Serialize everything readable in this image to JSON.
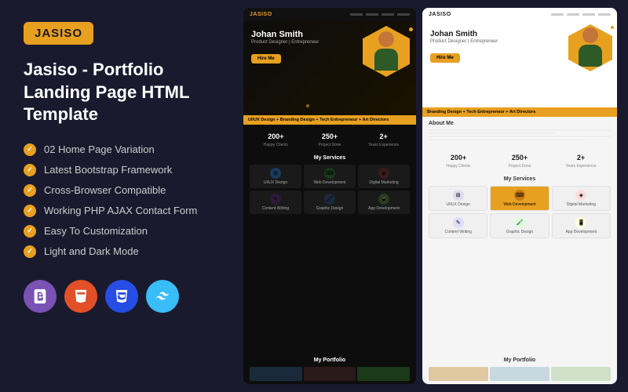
{
  "brand": {
    "name": "JASISO"
  },
  "leftPanel": {
    "title": "Jasiso - Portfolio Landing Page HTML Template",
    "features": [
      {
        "id": "feat1",
        "text": "02 Home Page Variation"
      },
      {
        "id": "feat2",
        "text": "Latest Bootstrap Framework"
      },
      {
        "id": "feat3",
        "text": "Cross-Browser Compatible"
      },
      {
        "id": "feat4",
        "text": "Working PHP AJAX Contact Form"
      },
      {
        "id": "feat5",
        "text": "Easy To Customization"
      },
      {
        "id": "feat6",
        "text": "Light and Dark Mode"
      }
    ],
    "techIcons": [
      {
        "id": "bootstrap",
        "label": "B",
        "title": "Bootstrap"
      },
      {
        "id": "html5",
        "label": "5",
        "title": "HTML5"
      },
      {
        "id": "css3",
        "label": "3",
        "title": "CSS3"
      },
      {
        "id": "tailwind",
        "label": "~",
        "title": "Tailwind"
      }
    ]
  },
  "darkPreview": {
    "navBrand": "JASISO",
    "heroName": "Johan Smith",
    "heroSub": "Product Designer | Entrepreneur",
    "heroBtnLabel": "Hire Me",
    "ticker": "UI/UX Design  +  Branding Design  +  Tech Entrepreneur  +  Art Directors",
    "stats": [
      {
        "num": "200+",
        "label": "Happy Clients"
      },
      {
        "num": "250+",
        "label": "Project Done"
      },
      {
        "num": "2+",
        "label": "Years Experience"
      }
    ],
    "servicesTitle": "My Services",
    "services": [
      {
        "name": "UI/UX Design",
        "icon": "⊞"
      },
      {
        "name": "Web Development",
        "icon": "⌨"
      },
      {
        "name": "Digital Marketing",
        "icon": "◈"
      },
      {
        "name": "Content Writing",
        "icon": "✎"
      },
      {
        "name": "Graphic Design",
        "icon": "🖌"
      },
      {
        "name": "App Development",
        "icon": "📱"
      }
    ],
    "portfolioTitle": "My Portfolio"
  },
  "lightPreview": {
    "navBrand": "JASISO",
    "heroName": "Johan Smith",
    "heroSub": "Product Designer | Entrepreneur",
    "heroBtnLabel": "Hire Me",
    "ticker": "Branding Design  +  Tech Entrepreneur  +  Art Directors",
    "aboutTitle": "About Me",
    "stats": [
      {
        "num": "200+",
        "label": "Happy Clients"
      },
      {
        "num": "250+",
        "label": "Project Done"
      },
      {
        "num": "2+",
        "label": "Years Experience"
      }
    ],
    "servicesTitle": "My Services",
    "services": [
      {
        "name": "UI/UX Design",
        "icon": "⊞"
      },
      {
        "name": "Web Development",
        "icon": "⌨",
        "highlight": true
      },
      {
        "name": "Digital Marketing",
        "icon": "◈"
      },
      {
        "name": "Content Writing",
        "icon": "✎"
      },
      {
        "name": "Graphic Design",
        "icon": "🖌"
      },
      {
        "name": "App Development",
        "icon": "📱"
      }
    ],
    "portfolioTitle": "My Portfolio"
  }
}
